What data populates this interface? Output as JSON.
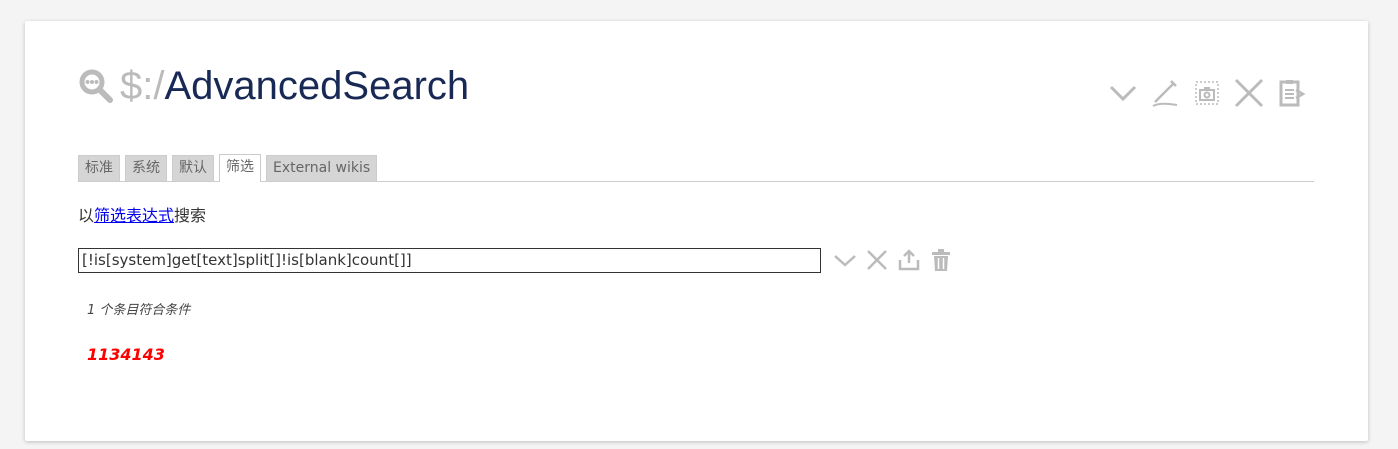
{
  "title": {
    "prefix": "$:/",
    "main": "AdvancedSearch",
    "icon": "advanced-search-icon"
  },
  "toolbar": {
    "buttons": [
      {
        "name": "more-actions",
        "icon": "chevron-down-icon"
      },
      {
        "name": "edit",
        "icon": "pencil-icon"
      },
      {
        "name": "export",
        "icon": "camera-icon"
      },
      {
        "name": "close",
        "icon": "close-icon"
      },
      {
        "name": "close-others",
        "icon": "close-others-icon"
      }
    ]
  },
  "tabs": [
    {
      "label": "标准",
      "active": false
    },
    {
      "label": "系统",
      "active": false
    },
    {
      "label": "默认",
      "active": false
    },
    {
      "label": "筛选",
      "active": true
    },
    {
      "label": "External wikis",
      "active": false
    }
  ],
  "hint": {
    "before": "以",
    "link": "筛选表达式",
    "after": "搜索"
  },
  "search": {
    "value": "[!is[system]get[text]split[]!is[blank]count[]]",
    "actions": [
      {
        "name": "filter-dropdown",
        "icon": "chevron-down-icon"
      },
      {
        "name": "clear",
        "icon": "close-icon"
      },
      {
        "name": "export",
        "icon": "export-icon"
      },
      {
        "name": "delete",
        "icon": "trash-icon"
      }
    ]
  },
  "results": {
    "count_text": "1 个条目符合条件",
    "items": [
      "1134143"
    ]
  },
  "colors": {
    "title": "#182955",
    "muted": "#bbbbbb",
    "link": "#0000ee",
    "missing": "#ff0000"
  }
}
